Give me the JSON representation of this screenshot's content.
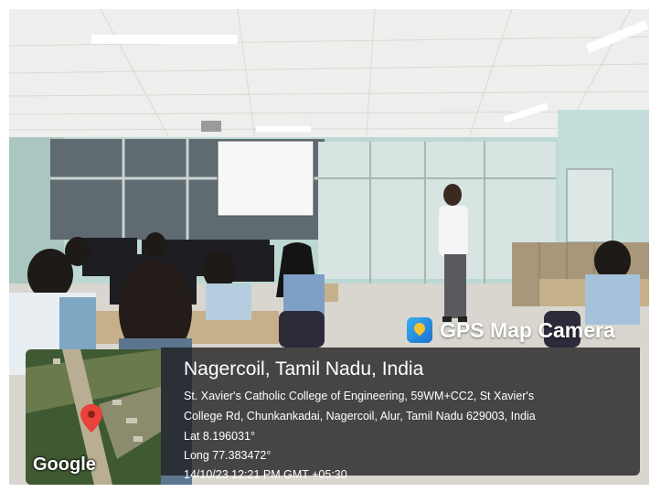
{
  "stamp": {
    "app_name": "GPS Map Camera",
    "location_title": "Nagercoil, Tamil Nadu, India",
    "address_line1": "St. Xavier's Catholic College of Engineering, 59WM+CC2, St Xavier's",
    "address_line2": "College Rd, Chunkankadai, Nagercoil, Alur, Tamil Nadu 629003, India",
    "latitude": "Lat 8.196031°",
    "longitude": "Long 77.383472°",
    "datetime": "14/10/23 12:21 PM GMT +05:30",
    "map_brand": "Google"
  },
  "colors": {
    "stamp_background": "#1c1c1c",
    "map_pin": "#e8423a",
    "wall": "#bcd8d2",
    "ceiling": "#f2f2f0"
  }
}
